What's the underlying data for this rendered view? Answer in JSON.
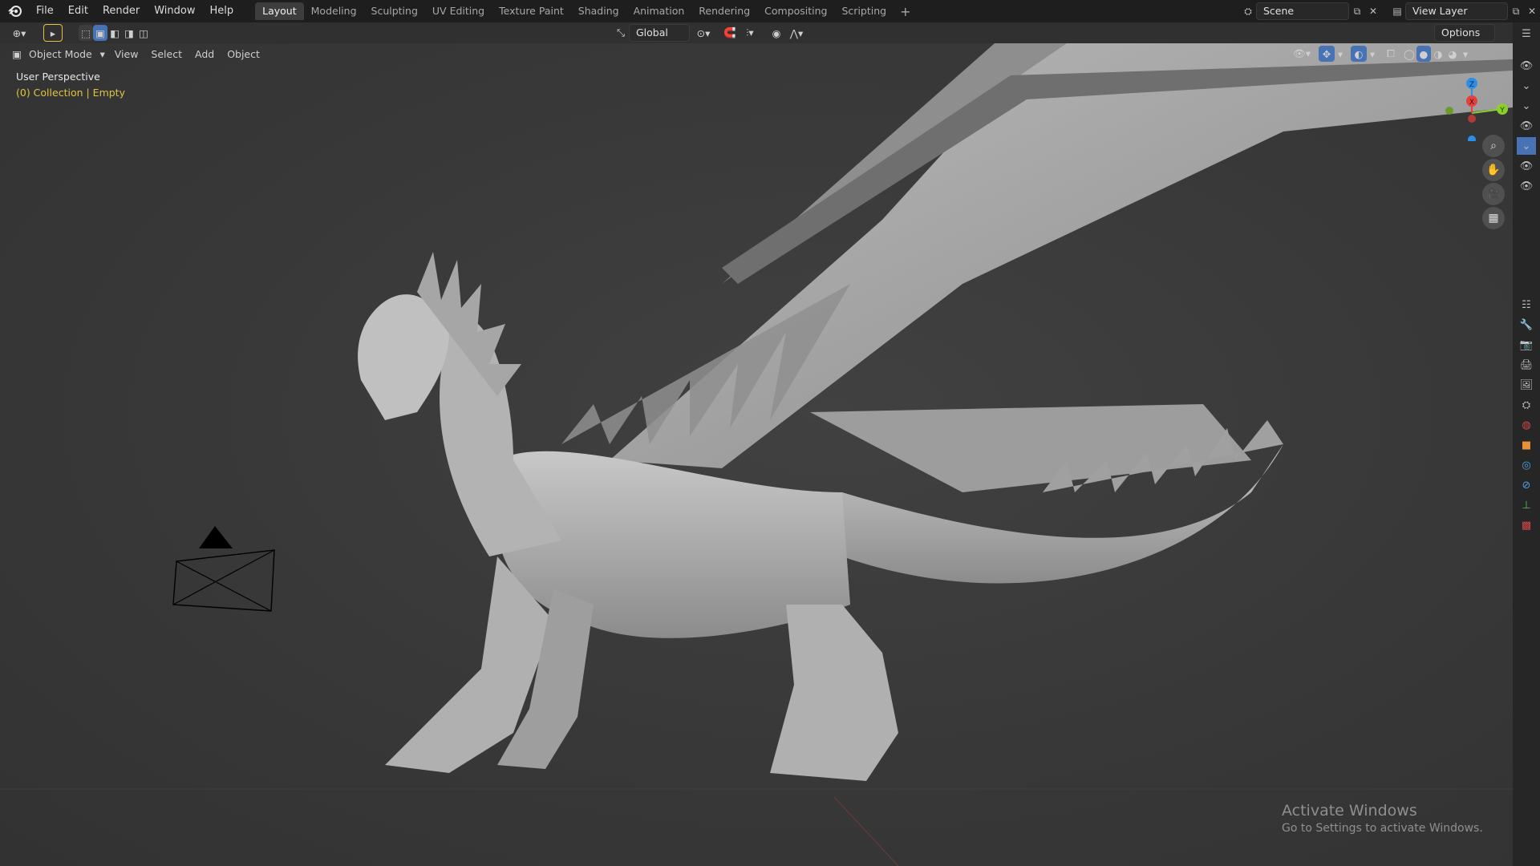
{
  "menu": {
    "logo_icon": "blender-logo-icon",
    "items": [
      "File",
      "Edit",
      "Render",
      "Window",
      "Help"
    ]
  },
  "workspaces": {
    "tabs": [
      "Layout",
      "Modeling",
      "Sculpting",
      "UV Editing",
      "Texture Paint",
      "Shading",
      "Animation",
      "Rendering",
      "Compositing",
      "Scripting"
    ],
    "active": "Layout",
    "add_label": "+"
  },
  "scene": {
    "scene_name": "Scene",
    "view_layer": "View Layer"
  },
  "header": {
    "transform_orientation": "Global",
    "options_label": "Options"
  },
  "toolheader": {
    "mode": "Object Mode",
    "menus": [
      "View",
      "Select",
      "Add",
      "Object"
    ]
  },
  "viewport": {
    "perspective_label": "User Perspective",
    "collection_label": "(0) Collection | Empty",
    "gizmo_axes": [
      "X",
      "Y",
      "Z"
    ]
  },
  "watermark": {
    "title": "Activate Windows",
    "subtitle": "Go to Settings to activate Windows."
  },
  "colors": {
    "accent": "#4772b3",
    "collection_text": "#e0c341",
    "axis_x": "#e4413d",
    "axis_y": "#8ccf2c",
    "axis_z": "#2d8ee8"
  }
}
